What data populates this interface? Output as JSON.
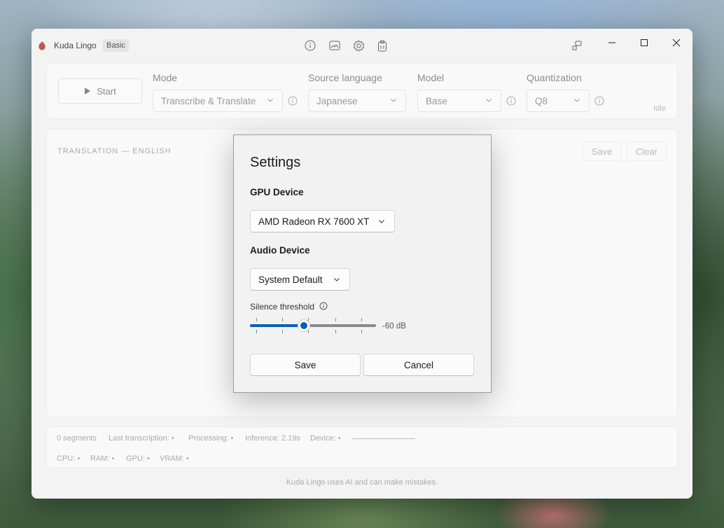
{
  "app": {
    "title": "Kuda Lingo",
    "badge": "Basic"
  },
  "title_icons": [
    "info-icon",
    "image-icon",
    "gear-icon",
    "clipboard-icon"
  ],
  "toolbar": {
    "start_label": "Start",
    "mode": {
      "label": "Mode",
      "value": "Transcribe & Translate"
    },
    "source_language": {
      "label": "Source language",
      "value": "Japanese"
    },
    "model": {
      "label": "Model",
      "value": "Base"
    },
    "quantization": {
      "label": "Quantization",
      "value": "Q8"
    },
    "status": "Idle"
  },
  "main": {
    "section_title": "TRANSLATION — ENGLISH",
    "save_label": "Save",
    "clear_label": "Clear"
  },
  "status_bar": {
    "segments": "0 segments",
    "last_transcription": "Last transcription: •",
    "processing": "Processing: •",
    "inference": "Inference: 2.19s",
    "device": "Device: •",
    "cpu": "CPU: •",
    "ram": "RAM: •",
    "gpu": "GPU: •",
    "vram": "VRAM: •"
  },
  "footer": "Kuda Lingo uses AI and can make mistakes.",
  "dialog": {
    "title": "Settings",
    "gpu_device_label": "GPU Device",
    "gpu_device_value": "AMD Radeon RX 7600 XT",
    "audio_device_label": "Audio Device",
    "audio_device_value": "System Default",
    "silence_label": "Silence threshold",
    "silence_value": "-60 dB",
    "silence_level_fraction": 0.43,
    "save_label": "Save",
    "cancel_label": "Cancel"
  },
  "colors": {
    "accent": "#0a5fb4",
    "window_bg": "#f3f3f3",
    "dialog_border": "#9c9c9c"
  }
}
